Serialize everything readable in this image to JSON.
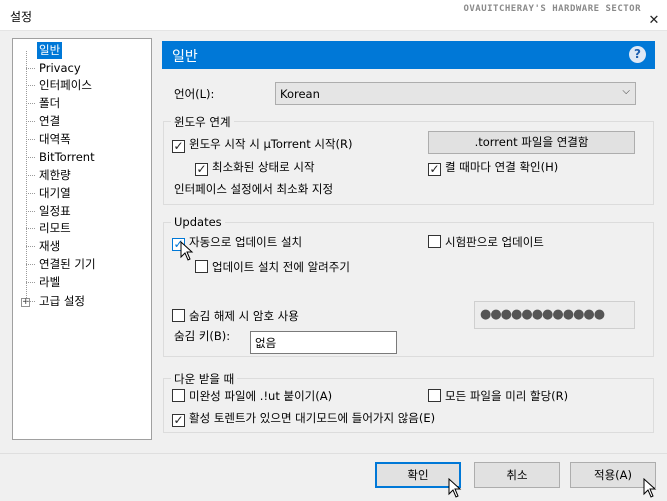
{
  "window": {
    "title": "설정",
    "brand": "OVAUITCHERAY'S HARDWARE SECTOR",
    "close_glyph": "✕"
  },
  "sidebar": {
    "expander_glyph": "+",
    "items": [
      {
        "label": "일반"
      },
      {
        "label": "Privacy"
      },
      {
        "label": "인터페이스"
      },
      {
        "label": "폴더"
      },
      {
        "label": "연결"
      },
      {
        "label": "대역폭"
      },
      {
        "label": "BitTorrent"
      },
      {
        "label": "제한량"
      },
      {
        "label": "대기열"
      },
      {
        "label": "일정표"
      },
      {
        "label": "리모트"
      },
      {
        "label": "재생"
      },
      {
        "label": "연결된 기기"
      },
      {
        "label": "라벨"
      },
      {
        "label": "고급 설정"
      }
    ],
    "selected": "일반"
  },
  "header": {
    "title": "일반",
    "help": "?"
  },
  "language": {
    "label": "언어(L):",
    "value": "Korean"
  },
  "windows_group": {
    "title": "윈도우 연계",
    "start_with_windows": {
      "label": "윈도우 시작 시 µTorrent 시작(R)",
      "checked": true
    },
    "start_minimized": {
      "label": "최소화된 상태로 시작",
      "checked": true
    },
    "associate_button": ".torrent 파일을 연결함",
    "check_association": {
      "label": "켤 때마다 연결 확인(H)",
      "checked": true
    },
    "minimize_note": "인터페이스 설정에서 최소화 지정"
  },
  "updates_group": {
    "title": "Updates",
    "auto_update": {
      "label": "자동으로 업데이트 설치",
      "checked": true
    },
    "beta_update": {
      "label": "시험판으로 업데이트",
      "checked": false
    },
    "notify_before": {
      "label": "업데이트 설치 전에 알려주기",
      "checked": false
    },
    "use_password": {
      "label": "숨김 해제 시 암호 사용",
      "checked": false
    },
    "password_mask": "●●●●●●●●●●●●",
    "boss_key_label": "숨김 키(B):",
    "boss_key_value": "없음"
  },
  "download_group": {
    "title": "다운 받을 때",
    "append_lut": {
      "label": "미완성 파일에 .!ut 붙이기(A)",
      "checked": false
    },
    "preallocate": {
      "label": "모든 파일을 미리 할당(R)",
      "checked": false
    },
    "prevent_standby": {
      "label": "활성 토렌트가 있으면 대기모드에 들어가지 않음(E)",
      "checked": true
    }
  },
  "footer": {
    "ok": "확인",
    "cancel": "취소",
    "apply": "적용(A)"
  },
  "glyphs": {
    "check": "✓",
    "dropdown": "⌵"
  },
  "colors": {
    "accent": "#0078d7",
    "selection": "#0078d7"
  }
}
